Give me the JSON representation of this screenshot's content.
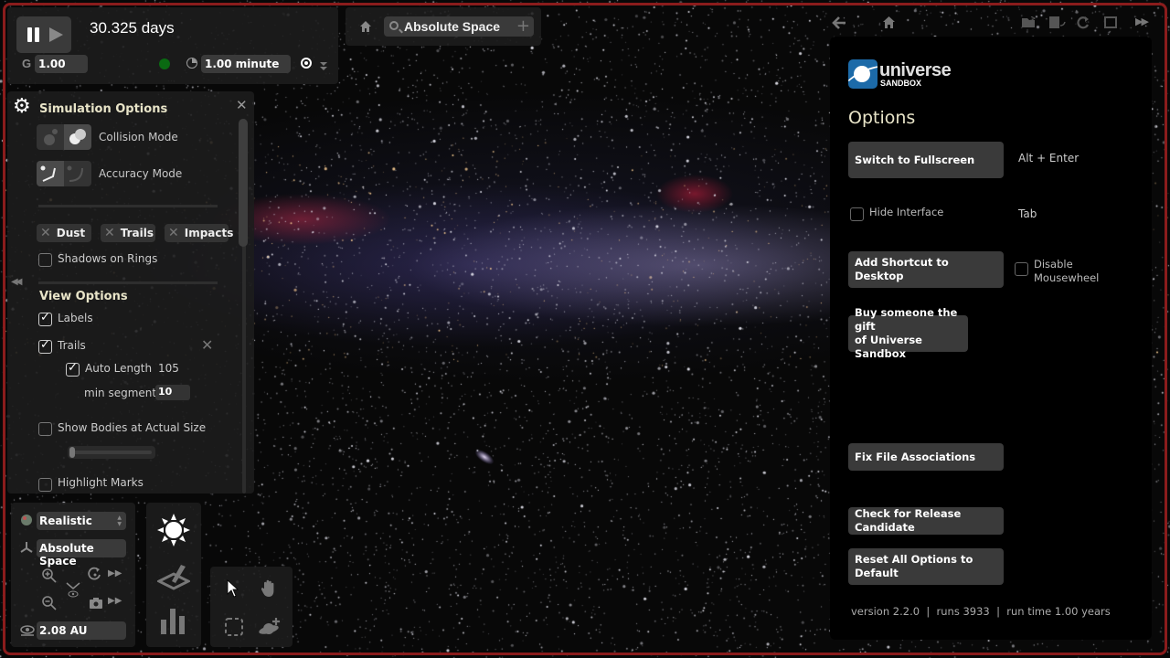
{
  "time_bar": {
    "elapsed": "30.325 days",
    "gravity_label": "G",
    "gravity_value": "1.00",
    "timestep_value": "1.00 minute"
  },
  "search_bar": {
    "value": "Absolute Space"
  },
  "simulation_options": {
    "title": "Simulation Options",
    "collision_mode_label": "Collision Mode",
    "accuracy_mode_label": "Accuracy Mode",
    "chips": [
      "Dust",
      "Trails",
      "Impacts"
    ],
    "shadows_on_rings": {
      "label": "Shadows on Rings",
      "checked": false
    }
  },
  "view_options": {
    "title": "View Options",
    "labels": {
      "label": "Labels",
      "checked": true
    },
    "trails": {
      "label": "Trails",
      "checked": true
    },
    "auto_length": {
      "label": "Auto Length",
      "checked": true,
      "value": "105"
    },
    "min_segments": {
      "label": "min segments",
      "value": "10"
    },
    "show_actual_size": {
      "label": "Show Bodies at Actual Size",
      "checked": false,
      "slider_fraction": 0.0
    },
    "highlight_marks": {
      "label": "Highlight Marks",
      "checked": false
    }
  },
  "view_panel": {
    "render_mode": "Realistic",
    "reference_frame": "Absolute Space",
    "distance": "2.08 AU"
  },
  "options_panel": {
    "brand_word": "universe",
    "brand_sub": "SANDBOX",
    "title": "Options",
    "buttons": {
      "fullscreen": "Switch to Fullscreen",
      "shortcut": "Add Shortcut to Desktop",
      "gift_line1": "Buy someone the gift",
      "gift_line2": "of Universe Sandbox",
      "file_assoc": "Fix File Associations",
      "release_candidate": "Check for Release Candidate",
      "reset": "Reset All Options to Default"
    },
    "fullscreen_key": "Alt + Enter",
    "hide_interface": {
      "label": "Hide Interface",
      "checked": false,
      "key": "Tab"
    },
    "disable_mousewheel": {
      "label_line1": "Disable",
      "label_line2": "Mousewheel",
      "checked": false
    },
    "footer": "version 2.2.0  |  runs 3933  |  run time 1.00 years"
  },
  "colors": {
    "frame": "#8a1c1c",
    "panel_title": "#e8e4c8",
    "status_dot": "#0a6a12",
    "brand_blue": "#1c6aa8"
  }
}
